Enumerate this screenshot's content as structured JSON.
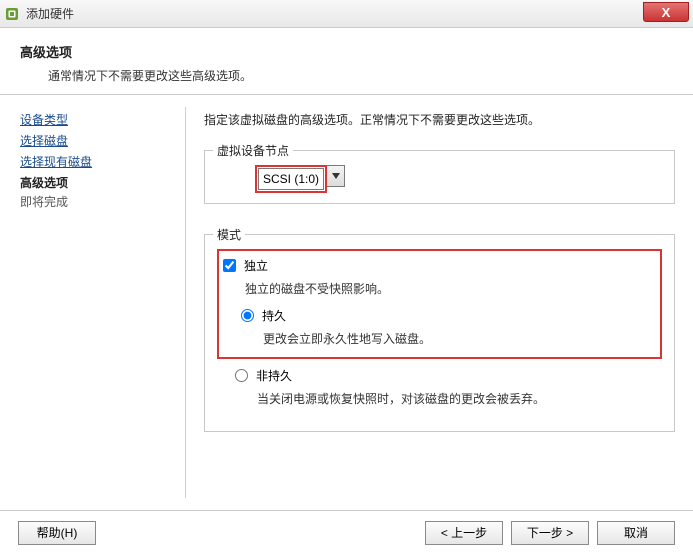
{
  "window": {
    "title": "添加硬件",
    "close_symbol": "X"
  },
  "header": {
    "title": "高级选项",
    "subtitle": "通常情况下不需要更改这些高级选项。"
  },
  "sidebar": {
    "links": {
      "device_type": "设备类型",
      "select_disk": "选择磁盘",
      "select_existing": "选择现有磁盘"
    },
    "current": "高级选项",
    "next": "即将完成"
  },
  "main": {
    "instruction": "指定该虚拟磁盘的高级选项。正常情况下不需要更改这些选项。",
    "node_group": {
      "legend": "虚拟设备节点",
      "selected": "SCSI (1:0)"
    },
    "mode_group": {
      "legend": "模式",
      "independent": {
        "label": "独立",
        "desc": "独立的磁盘不受快照影响。"
      },
      "persistent": {
        "label": "持久",
        "desc": "更改会立即永久性地写入磁盘。"
      },
      "nonpersistent": {
        "label": "非持久",
        "desc": "当关闭电源或恢复快照时，对该磁盘的更改会被丢弃。"
      }
    }
  },
  "footer": {
    "help": "帮助(H)",
    "back": "< 上一步",
    "next": "下一步 >",
    "cancel": "取消"
  }
}
